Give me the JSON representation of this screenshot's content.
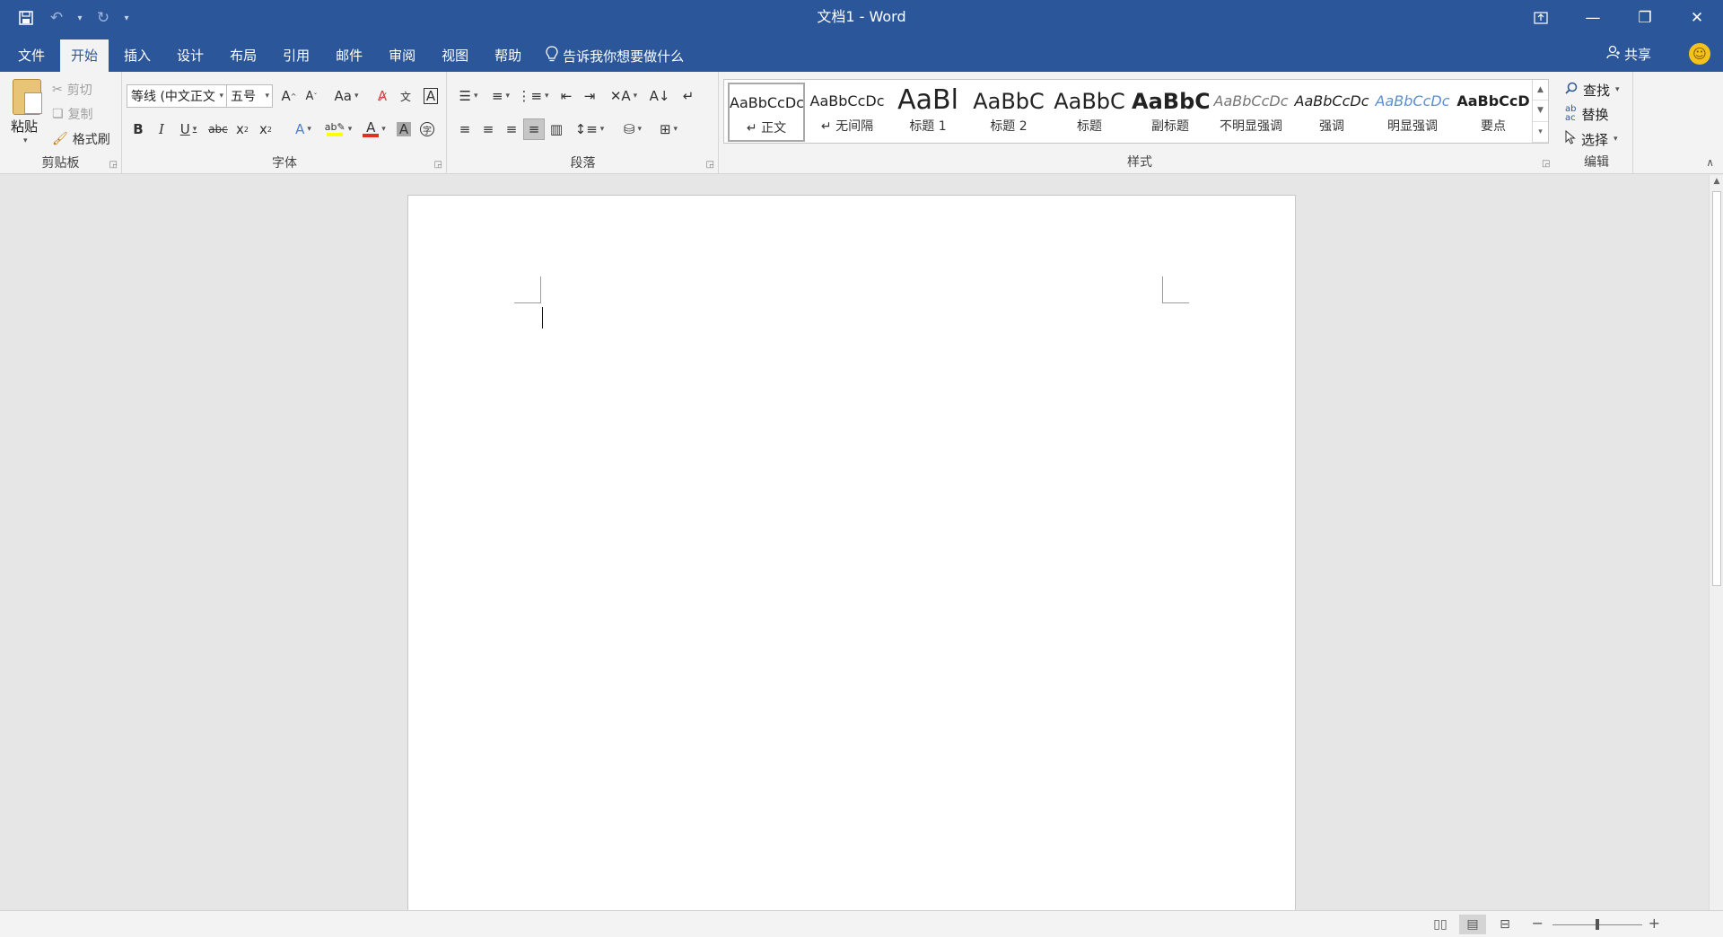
{
  "window": {
    "title": "文档1  -  Word",
    "qat": {
      "save_icon": "save-icon",
      "undo_icon": "undo-icon",
      "redo_icon": "redo-icon"
    }
  },
  "tabs": [
    {
      "label": "文件"
    },
    {
      "label": "开始",
      "active": true
    },
    {
      "label": "插入"
    },
    {
      "label": "设计"
    },
    {
      "label": "布局"
    },
    {
      "label": "引用"
    },
    {
      "label": "邮件"
    },
    {
      "label": "审阅"
    },
    {
      "label": "视图"
    },
    {
      "label": "帮助"
    }
  ],
  "tellme": "告诉我你想要做什么",
  "share": "共享",
  "clipboard": {
    "paste": "粘贴",
    "cut": "剪切",
    "copy": "复制",
    "format_painter": "格式刷",
    "label": "剪贴板"
  },
  "font": {
    "font_name": "等线 (中文正文",
    "font_size": "五号",
    "change_case": "Aa",
    "label": "字体"
  },
  "paragraph": {
    "label": "段落"
  },
  "styles": {
    "label": "样式",
    "items": [
      {
        "preview": "AaBbCcDc",
        "name": "↵ 正文"
      },
      {
        "preview": "AaBbCcDc",
        "name": "↵ 无间隔"
      },
      {
        "preview": "AaBl",
        "name": "标题 1"
      },
      {
        "preview": "AaBbC",
        "name": "标题 2"
      },
      {
        "preview": "AaBbC",
        "name": "标题"
      },
      {
        "preview": "AaBbC",
        "name": "副标题"
      },
      {
        "preview": "AaBbCcDc",
        "name": "不明显强调"
      },
      {
        "preview": "AaBbCcDc",
        "name": "强调"
      },
      {
        "preview": "AaBbCcDc",
        "name": "明显强调"
      },
      {
        "preview": "AaBbCcD",
        "name": "要点"
      }
    ]
  },
  "editing": {
    "find": "查找",
    "replace": "替换",
    "select": "选择",
    "label": "编辑"
  },
  "colors": {
    "brand": "#2b579a",
    "highlight": "#ffff00",
    "font_color": "#e0301e"
  }
}
